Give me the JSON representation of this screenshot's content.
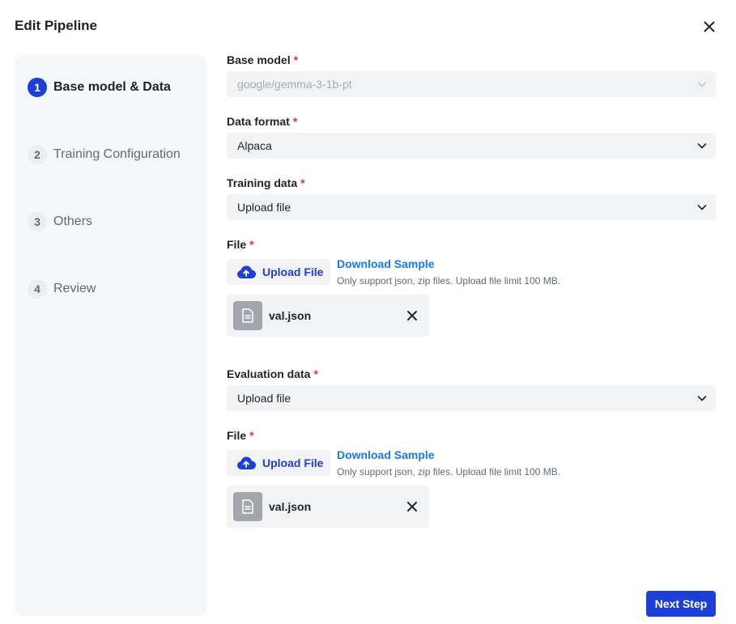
{
  "dialog": {
    "title": "Edit Pipeline",
    "close_icon": "close-icon"
  },
  "stepper": {
    "steps": [
      {
        "number": "1",
        "label": "Base model & Data",
        "active": true
      },
      {
        "number": "2",
        "label": "Training Configuration",
        "active": false
      },
      {
        "number": "3",
        "label": "Others",
        "active": false
      },
      {
        "number": "4",
        "label": "Review",
        "active": false
      }
    ]
  },
  "form": {
    "base_model": {
      "label": "Base model",
      "required": "*",
      "value": "google/gemma-3-1b-pt",
      "disabled": true
    },
    "data_format": {
      "label": "Data format",
      "required": "*",
      "value": "Alpaca"
    },
    "training_data": {
      "label": "Training data",
      "required": "*",
      "value": "Upload file"
    },
    "training_file": {
      "label": "File",
      "required": "*",
      "upload_label": "Upload File",
      "download_label": "Download Sample",
      "hint": "Only support json, zip files. Upload file limit 100 MB.",
      "file_name": "val.json"
    },
    "evaluation_data": {
      "label": "Evaluation data",
      "required": "*",
      "value": "Upload file"
    },
    "evaluation_file": {
      "label": "File",
      "required": "*",
      "upload_label": "Upload File",
      "download_label": "Download Sample",
      "hint": "Only support json, zip files. Upload file limit 100 MB.",
      "file_name": "val.json"
    }
  },
  "footer": {
    "next_label": "Next Step"
  },
  "colors": {
    "primary": "#1d3fd8",
    "link": "#1677ff",
    "required": "#e5323a"
  }
}
